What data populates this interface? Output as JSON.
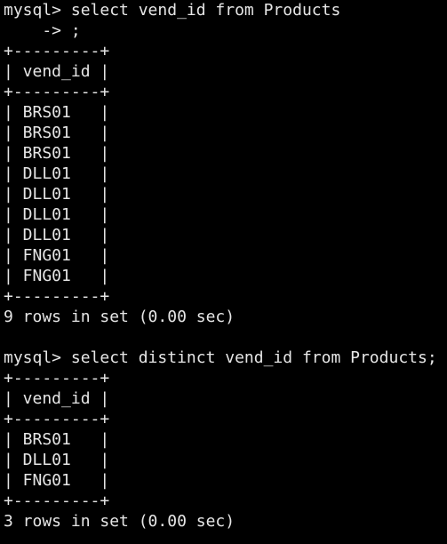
{
  "colors": {
    "background": "#000000",
    "foreground": "#e6e6e6"
  },
  "query1": {
    "prompt_line": "mysql> select vend_id from Products",
    "continuation_line": "    -> ;",
    "border": "+---------+",
    "header": "| vend_id |",
    "rows": [
      "| BRS01   |",
      "| BRS01   |",
      "| BRS01   |",
      "| DLL01   |",
      "| DLL01   |",
      "| DLL01   |",
      "| DLL01   |",
      "| FNG01   |",
      "| FNG01   |"
    ],
    "result": "9 rows in set (0.00 sec)"
  },
  "query2": {
    "prompt_line": "mysql> select distinct vend_id from Products;",
    "border": "+---------+",
    "header": "| vend_id |",
    "rows": [
      "| BRS01   |",
      "| DLL01   |",
      "| FNG01   |"
    ],
    "result": "3 rows in set (0.00 sec)"
  }
}
